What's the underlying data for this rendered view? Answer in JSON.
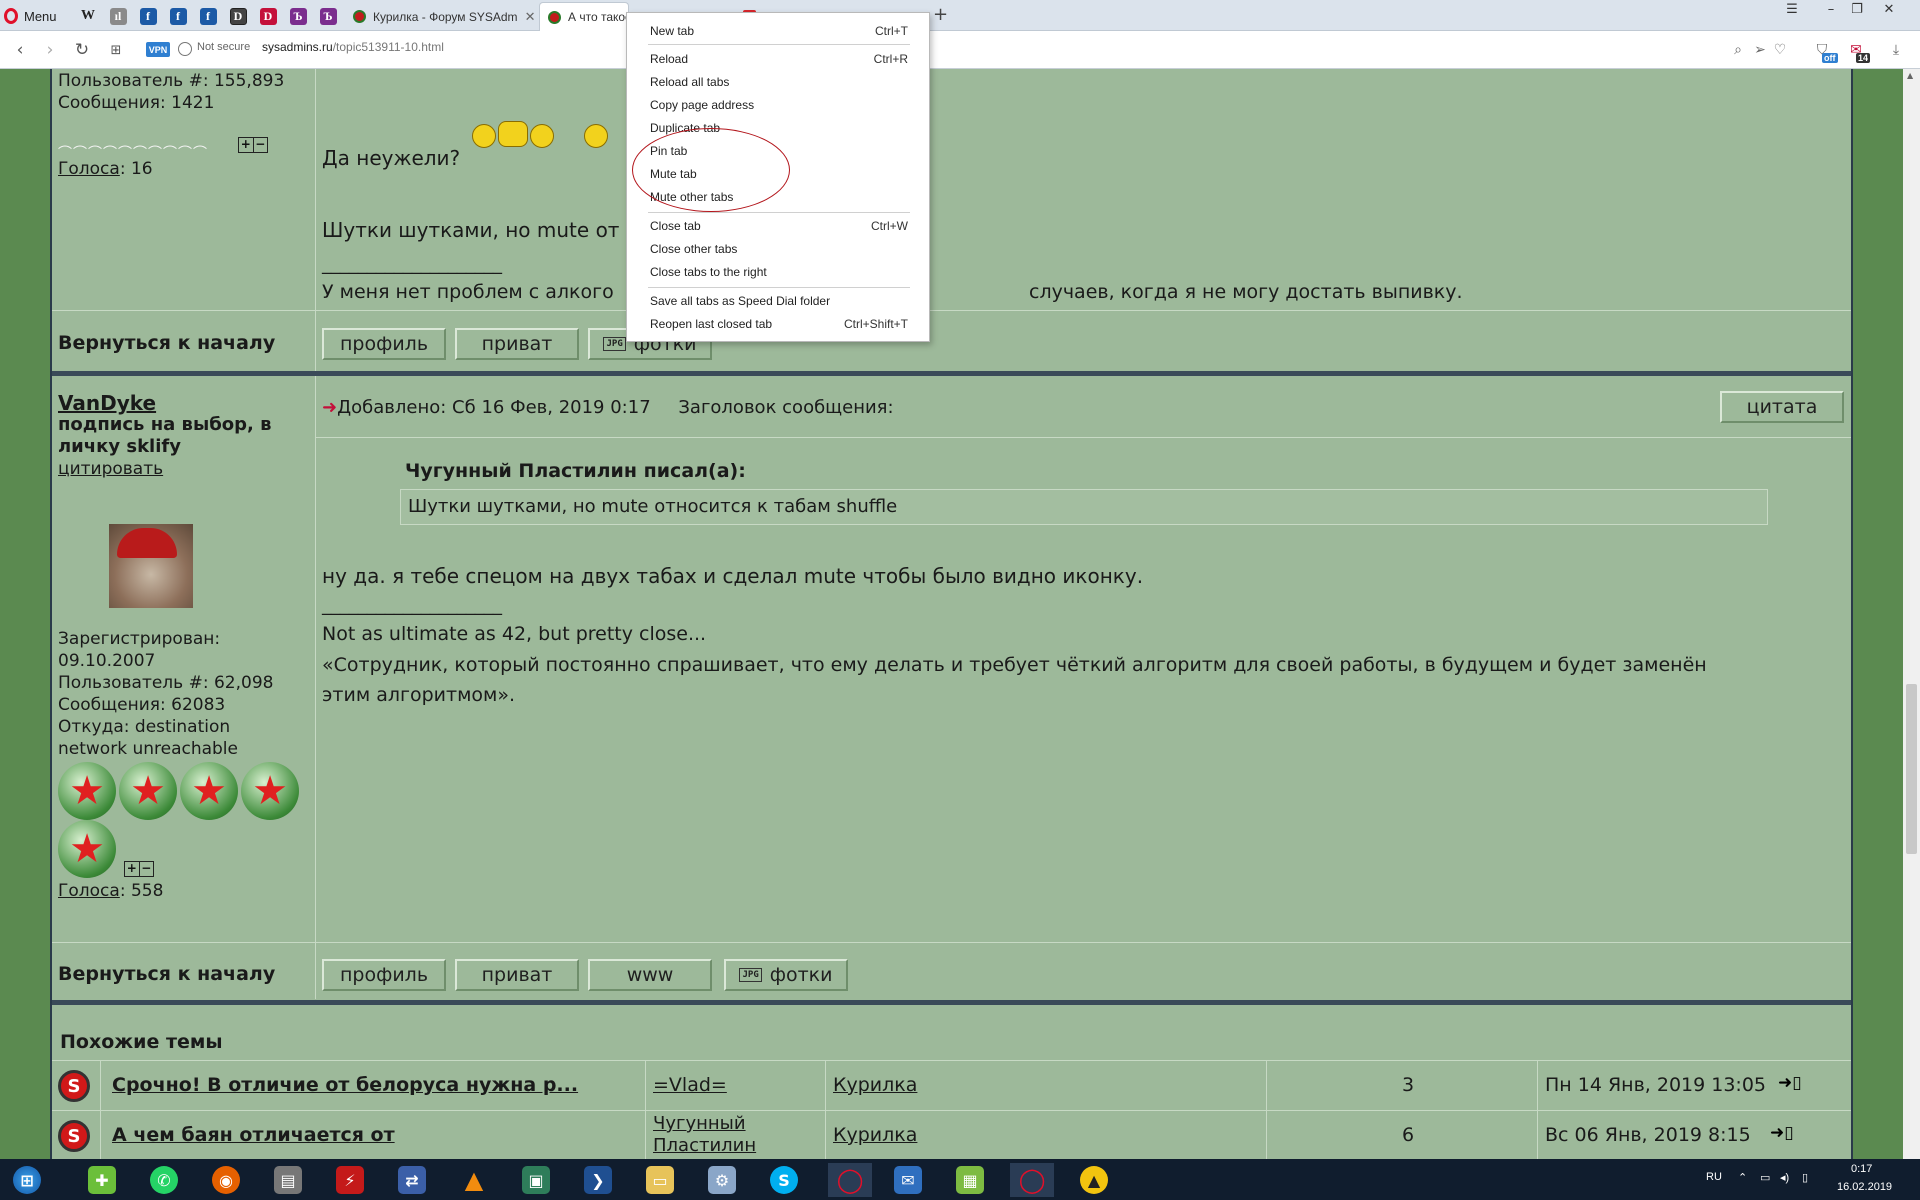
{
  "browser": {
    "menu_label": "Menu",
    "pinned_tabs": [
      {
        "icon": "wikipedia-icon",
        "label": "W",
        "color": "#ffffff"
      },
      {
        "icon": "ll-icon",
        "label": "ıl",
        "color": "#ffffff"
      },
      {
        "icon": "f-icon",
        "label": "f",
        "color": "#1c5aa6"
      },
      {
        "icon": "f-icon",
        "label": "f",
        "color": "#1c5aa6"
      },
      {
        "icon": "f-icon",
        "label": "f",
        "color": "#1c5aa6"
      },
      {
        "icon": "d-icon",
        "label": "D",
        "color": "#ffffff"
      },
      {
        "icon": "d-red-icon",
        "label": "D",
        "color": "#c4103a"
      },
      {
        "icon": "b-purple-icon",
        "label": "Ъ",
        "color": "#ffffff"
      },
      {
        "icon": "b-purple-icon",
        "label": "Ъ",
        "color": "#ffffff"
      }
    ],
    "tabs": [
      {
        "title": "Курилка - Форум SYSAdm",
        "active": false
      },
      {
        "title": "А что такое...",
        "active": true
      },
      {
        "title": "",
        "active": false
      }
    ],
    "new_tab_label": "+",
    "address": {
      "vpn": "VPN",
      "not_secure": "Not secure",
      "host": "sysadmins.ru",
      "path": "/topic513911-10.html"
    },
    "badges": {
      "adblock": "off",
      "messages": "14"
    }
  },
  "context_menu": {
    "groups": [
      [
        {
          "label": "New tab",
          "shortcut": "Ctrl+T"
        }
      ],
      [
        {
          "label": "Reload",
          "shortcut": "Ctrl+R"
        },
        {
          "label": "Reload all tabs",
          "shortcut": ""
        },
        {
          "label": "Copy page address",
          "shortcut": ""
        },
        {
          "label": "Duplicate tab",
          "shortcut": ""
        },
        {
          "label": "Pin tab",
          "shortcut": ""
        },
        {
          "label": "Mute tab",
          "shortcut": ""
        },
        {
          "label": "Mute other tabs",
          "shortcut": ""
        }
      ],
      [
        {
          "label": "Close tab",
          "shortcut": "Ctrl+W"
        },
        {
          "label": "Close other tabs",
          "shortcut": ""
        },
        {
          "label": "Close tabs to the right",
          "shortcut": ""
        }
      ],
      [
        {
          "label": "Save all tabs as Speed Dial folder",
          "shortcut": ""
        },
        {
          "label": "Reopen last closed tab",
          "shortcut": "Ctrl+Shift+T"
        }
      ]
    ]
  },
  "post1": {
    "user_number": "Пользователь #: 155,893",
    "messages": "Сообщения: 1421",
    "votes_label": "Голоса",
    "votes_value": ": 16",
    "text_line1": "Да неужели?",
    "text_line2": "Шутки шутками, но mute от",
    "signature_sep": "____________________",
    "signature": "У меня нет проблем с алкого",
    "signature_tail": "случаев, когда я не могу достать выпивку.",
    "back_to_top": "Вернуться к началу",
    "buttons": {
      "profile": "профиль",
      "private": "приват",
      "photos": "фотки",
      "jpg": "JPG"
    }
  },
  "post2": {
    "username": "VanDyke",
    "user_title": "подпись на выбор, в личку sklify",
    "quote_link": "цитировать",
    "registered_label": "Зарегистрирован:",
    "registered_date": "09.10.2007",
    "user_number": "Пользователь #: 62,098",
    "messages": "Сообщения: 62083",
    "location_label": "Откуда: destination",
    "location_line2": "network unreachable",
    "votes_label": "Голоса",
    "votes_value": ": 558",
    "added": "Добавлено: Сб 16 Фев, 2019 0:17",
    "subject_label": "Заголовок сообщения:",
    "quote_button": "цитата",
    "quote_author": "Чугунный Пластилин писал(а):",
    "quote_text": "Шутки шутками, но mute относится к табам shuffle",
    "body": "ну да. я тебе спецом на двух табах и сделал mute чтобы было видно иконку.",
    "signature_sep": "____________________",
    "signature1": "Not as ultimate as 42, but pretty close...",
    "signature2": "«Сотрудник, который постоянно спрашивает, что ему делать и требует чёткий алгоритм для своей работы, в будущем и будет заменён",
    "signature3": "этим алгоритмом».",
    "back_to_top": "Вернуться к началу",
    "buttons": {
      "profile": "профиль",
      "private": "приват",
      "www": "www",
      "photos": "фотки",
      "jpg": "JPG"
    }
  },
  "similar": {
    "header": "Похожие темы",
    "rows": [
      {
        "title": "Срочно! В отличие от белоруса нужна р...",
        "author": "=Vlad=",
        "author2": "",
        "forum": "Курилка",
        "replies": "3",
        "date": "Пн 14 Янв, 2019 13:05"
      },
      {
        "title": "А чем баян отличается от",
        "author": "Чугунный",
        "author2": "Пластилин",
        "forum": "Курилка",
        "replies": "6",
        "date": "Вс 06 Янв, 2019 8:15"
      }
    ]
  },
  "taskbar": {
    "lang": "RU",
    "time": "0:17",
    "date": "16.02.2019"
  }
}
